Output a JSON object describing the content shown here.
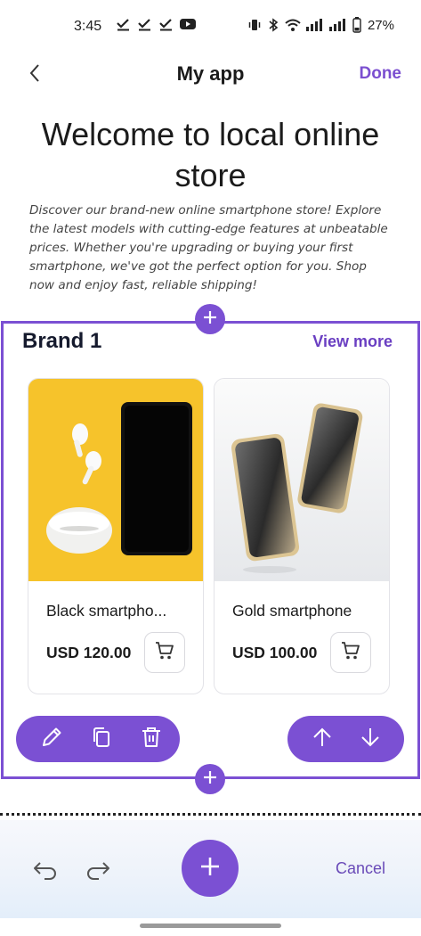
{
  "status_bar": {
    "time": "3:45",
    "left_icons": [
      "check-icon",
      "check-icon",
      "check-icon",
      "youtube-icon"
    ],
    "right_icons": [
      "vibrate-icon",
      "bluetooth-icon",
      "wifi-icon",
      "signal-icon",
      "signal-icon",
      "battery-icon"
    ],
    "battery": "27%"
  },
  "nav": {
    "back_icon": "chevron-left-icon",
    "title": "My app",
    "done_label": "Done"
  },
  "welcome": {
    "title": "Welcome to local online store",
    "description": "Discover our brand-new online smartphone store! Explore the latest models with cutting-edge features at unbeatable prices. Whether you're upgrading or buying your first smartphone, we've got the perfect option for you. Shop now and enjoy fast, reliable shipping!"
  },
  "section": {
    "title": "Brand 1",
    "view_more_label": "View more",
    "products": [
      {
        "name": "Black smartpho...",
        "price": "USD 120.00"
      },
      {
        "name": "Gold smartphone",
        "price": "USD 100.00"
      }
    ]
  },
  "toolbar": {
    "left_tools": [
      "edit-icon",
      "duplicate-icon",
      "delete-icon"
    ],
    "right_tools": [
      "arrow-up-icon",
      "arrow-down-icon"
    ]
  },
  "bottom_bar": {
    "cancel_label": "Cancel"
  },
  "colors": {
    "accent": "#7b50d3",
    "link": "#6a3fc2",
    "text": "#1b1b1b"
  }
}
